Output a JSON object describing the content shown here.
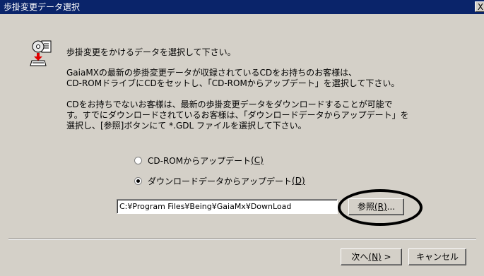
{
  "window": {
    "title": "歩掛変更データ選択",
    "close_glyph": "X"
  },
  "content": {
    "heading": "歩掛変更をかけるデータを選択して下さい。",
    "para1_line1": "GaiaMXの最新の歩掛変更データが収録されているCDをお持ちのお客様は、",
    "para1_line2": "CD-ROMドライブにCDをセットし、「CD-ROMからアップデート」を選択して下さい。",
    "para2_line1": "CDをお持ちでないお客様は、最新の歩掛変更データをダウンロードすることが可能で",
    "para2_line2": "す。すでにダウンロードされているお客様は、「ダウンロードデータからアップデート」を",
    "para2_line3": "選択し、[参照]ボタンにて *.GDL ファイルを選択して下さい。"
  },
  "options": {
    "cdrom_label": "CD-ROMからアップデート",
    "cdrom_hotkey": "(C)",
    "download_label": "ダウンロードデータからアップデート",
    "download_hotkey": "(D)",
    "selected": "download"
  },
  "path": {
    "value": "C:¥Program Files¥Being¥GaiaMx¥DownLoad"
  },
  "buttons": {
    "browse_label": "参照",
    "browse_hotkey": "(R)",
    "browse_suffix": "...",
    "next_label": "次へ",
    "next_hotkey": "(N)",
    "next_suffix": " >",
    "cancel_label": "キャンセル"
  },
  "icons": {
    "dialog_icon": "cd-document-icon",
    "close": "close-icon",
    "highlight": "annotation-circle"
  }
}
